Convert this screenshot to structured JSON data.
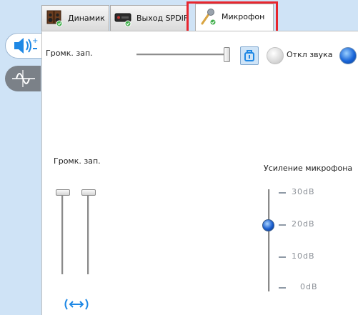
{
  "tabs": [
    {
      "label": "Динамик",
      "icon": "speakers-icon",
      "active": false
    },
    {
      "label": "Выход SPDIF",
      "icon": "spdif-device-icon",
      "active": false
    },
    {
      "label": "Микрофон",
      "icon": "microphone-icon",
      "active": true
    }
  ],
  "sidebar": {
    "items": [
      {
        "icon": "speaker-volume-icon",
        "active": true
      },
      {
        "icon": "sine-wave-icon",
        "active": false
      }
    ]
  },
  "record_volume": {
    "label": "Громк. зап.",
    "level": 1.0,
    "mute_label": "Откл звука"
  },
  "channels": {
    "label": "Громк. зап.",
    "left_level": 1.0,
    "right_level": 1.0
  },
  "boost": {
    "label": "Усиление микрофона",
    "ticks": [
      "30dB",
      "20dB",
      "10dB",
      "0dB"
    ],
    "value_db": 20
  },
  "colors": {
    "highlight": "#e8262e",
    "panel_bg": "#cfe3f6",
    "accent_blue": "#1a66d8"
  }
}
